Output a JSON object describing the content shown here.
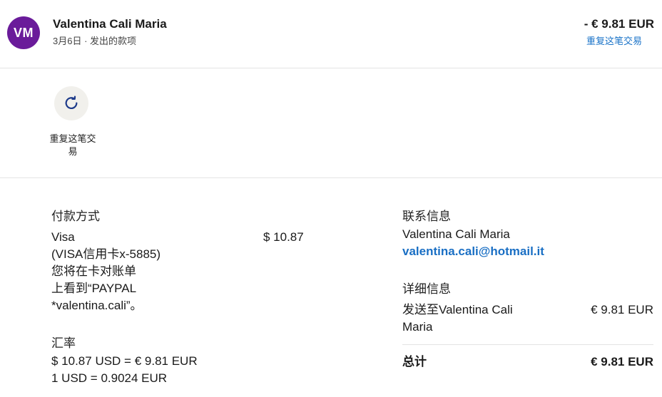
{
  "header": {
    "avatar_initials": "VM",
    "avatar_color": "#6a1b9a",
    "name": "Valentina Cali Maria",
    "meta": "3月6日 · 发出的款项",
    "amount": "- € 9.81 EUR",
    "repeat_link": "重复这笔交易"
  },
  "actions": {
    "repeat_icon": "refresh-icon",
    "repeat_label": "重复这笔交易"
  },
  "payment": {
    "title": "付款方式",
    "method_line1": "Visa",
    "method_line2": "(VISA信用卡x-5885)",
    "method_line3": "您将在卡对账单",
    "method_line4": "上看到“PAYPAL",
    "method_line5": "*valentina.cali”。",
    "amount": "$ 10.87"
  },
  "exchange": {
    "title": "汇率",
    "line1": "$ 10.87 USD = € 9.81 EUR",
    "line2": "1 USD = 0.9024 EUR"
  },
  "contact": {
    "title": "联系信息",
    "name": "Valentina Cali Maria",
    "email": "valentina.cali@hotmail.it"
  },
  "details": {
    "title": "详细信息",
    "sent_to_line1": "发送至Valentina Cali",
    "sent_to_line2": "Maria",
    "sent_amount": "€ 9.81 EUR",
    "total_label": "总计",
    "total_amount": "€ 9.81 EUR"
  }
}
